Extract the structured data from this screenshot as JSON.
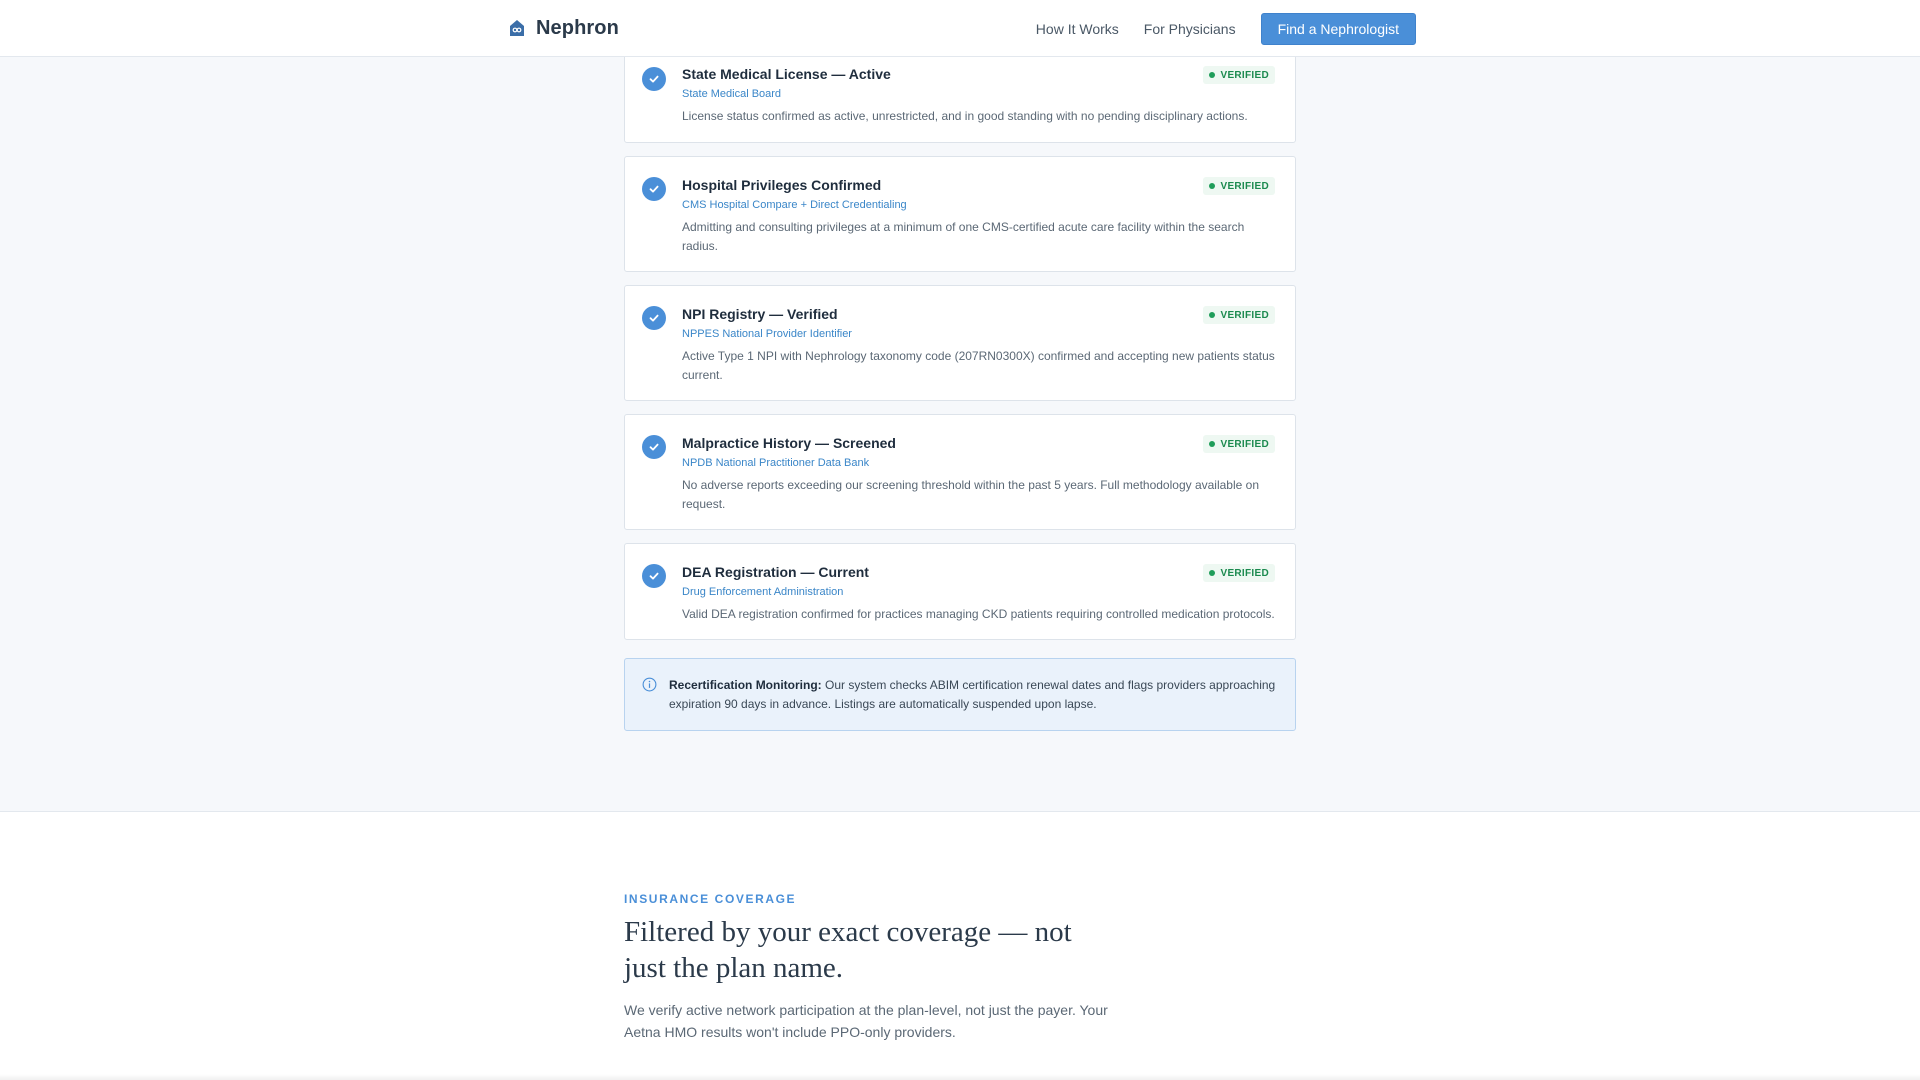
{
  "header": {
    "brand": "Nephron",
    "nav": [
      "How It Works",
      "For Physicians"
    ],
    "cta": "Find a Nephrologist"
  },
  "credentials": [
    {
      "title": "State Medical License — Active",
      "source": "State Medical Board",
      "desc": "License status confirmed as active, unrestricted, and in good standing with no pending disciplinary actions.",
      "badge": "VERIFIED"
    },
    {
      "title": "Hospital Privileges Confirmed",
      "source": "CMS Hospital Compare + Direct Credentialing",
      "desc": "Admitting and consulting privileges at a minimum of one CMS-certified acute care facility within the search radius.",
      "badge": "VERIFIED"
    },
    {
      "title": "NPI Registry — Verified",
      "source": "NPPES National Provider Identifier",
      "desc": "Active Type 1 NPI with Nephrology taxonomy code (207RN0300X) confirmed and accepting new patients status current.",
      "badge": "VERIFIED"
    },
    {
      "title": "Malpractice History — Screened",
      "source": "NPDB National Practitioner Data Bank",
      "desc": "No adverse reports exceeding our screening threshold within the past 5 years. Full methodology available on request.",
      "badge": "VERIFIED"
    },
    {
      "title": "DEA Registration — Current",
      "source": "Drug Enforcement Administration",
      "desc": "Valid DEA registration confirmed for practices managing CKD patients requiring controlled medication protocols.",
      "badge": "VERIFIED"
    }
  ],
  "info": {
    "label": "Recertification Monitoring:",
    "text": " Our system checks ABIM certification renewal dates and flags providers approaching expiration 90 days in advance. Listings are automatically suspended upon lapse."
  },
  "insurance": {
    "eyebrow": "INSURANCE COVERAGE",
    "title": "Filtered by your exact coverage — not just the plan name.",
    "subtitle": "We verify active network participation at the plan-level, not just the payer. Your Aetna HMO results won't include PPO-only providers."
  },
  "colors": {
    "accent": "#4a8fd8",
    "verified": "#1b8a4f",
    "source_link": "#3a86c8"
  }
}
